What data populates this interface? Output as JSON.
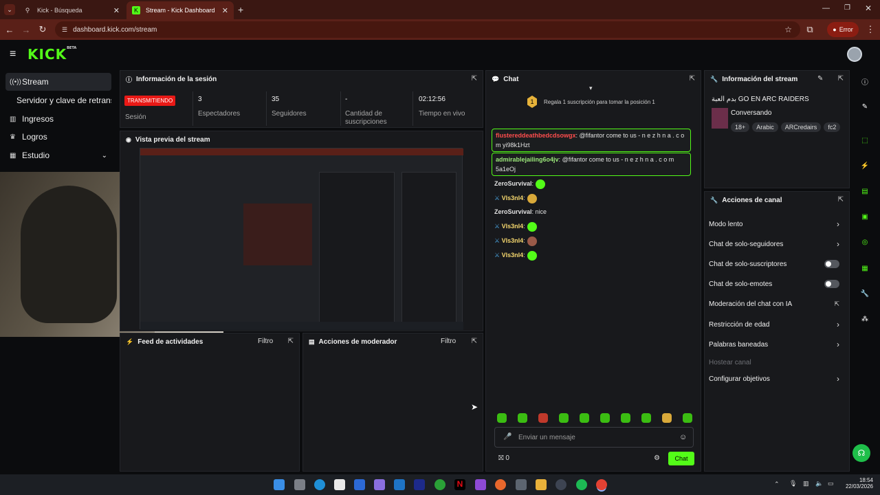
{
  "browser": {
    "tabs": [
      {
        "title": "Kick - Búsqueda",
        "active": false
      },
      {
        "title": "Stream - Kick Dashboard",
        "active": true
      }
    ],
    "url": "dashboard.kick.com/stream",
    "error_label": "Error"
  },
  "header": {
    "logo": "KICK",
    "logo_badge": "BETA"
  },
  "sidebar": {
    "items": [
      {
        "label": "Stream",
        "icon": "broadcast-icon",
        "active": true
      },
      {
        "label": "Servidor y clave de retransmi",
        "icon": "",
        "active": false
      },
      {
        "label": "Ingresos",
        "icon": "chart-icon",
        "active": false
      },
      {
        "label": "Logros",
        "icon": "trophy-icon",
        "active": false
      },
      {
        "label": "Estudio",
        "icon": "film-icon",
        "active": false
      }
    ]
  },
  "session": {
    "title": "Información de la sesión",
    "status_badge": "TRANSMITIENDO",
    "status_label": "Sesión",
    "stats": [
      {
        "value": "3",
        "label": "Espectadores"
      },
      {
        "value": "35",
        "label": "Seguidores"
      },
      {
        "value": "-",
        "label": "Cantidad de suscripciones"
      },
      {
        "value": "02:12:56",
        "label": "Tiempo en vivo"
      }
    ]
  },
  "preview": {
    "title": "Vista previa del stream"
  },
  "feed": {
    "title": "Feed de actividades",
    "filter": "Filtro"
  },
  "modactions": {
    "title": "Acciones de moderador",
    "filter": "Filtro"
  },
  "chat": {
    "title": "Chat",
    "gift_text": "Regala 1 suscripción para tomar la posición 1",
    "gift_rank": "1",
    "messages": [
      {
        "user": "flustereddeathbedcdsowgx",
        "text": "@fifantor come to us - n e z h n a . c o m yi98k1Hzt",
        "flagged": true,
        "color": "#ff4d4d"
      },
      {
        "user": "admirablejailing6o4jv",
        "text": "@fifantor come to us - n e z h n a . c o m 5a1eOj",
        "flagged": true,
        "color": "#9be87a"
      },
      {
        "user": "ZeroSurvival",
        "text": "",
        "emote": true,
        "color": "#d7e8c8"
      },
      {
        "user": "Vls3nI4",
        "text": "",
        "emote": true,
        "color": "#f5d76e"
      },
      {
        "user": "ZeroSurvival",
        "text": "nice",
        "emote": false,
        "color": "#d7e8c8"
      },
      {
        "user": "Vls3nI4",
        "text": "",
        "emote": true,
        "color": "#f5d76e"
      },
      {
        "user": "Vls3nI4",
        "text": "",
        "emote": true,
        "color": "#f5d76e"
      },
      {
        "user": "Vls3nI4",
        "text": "",
        "emote": true,
        "color": "#f5d76e"
      }
    ],
    "input_placeholder": "Enviar un mensaje",
    "points": "0",
    "send_label": "Chat"
  },
  "stream_info": {
    "title": "Información del stream",
    "stream_title": "بدم العبة GO EN ARC RAIDERS",
    "category": "Conversando",
    "tags": [
      "18+",
      "Arabic",
      "ARCredairs",
      "fc2"
    ]
  },
  "channel_actions": {
    "title": "Acciones de canal",
    "items": [
      {
        "label": "Modo lento",
        "control": "chevron"
      },
      {
        "label": "Chat de solo-seguidores",
        "control": "chevron"
      },
      {
        "label": "Chat de solo-suscriptores",
        "control": "toggle"
      },
      {
        "label": "Chat de solo-emotes",
        "control": "toggle"
      },
      {
        "label": "Moderación del chat con IA",
        "control": "external"
      },
      {
        "label": "Restricción de edad",
        "control": "chevron"
      },
      {
        "label": "Palabras baneadas",
        "control": "chevron"
      },
      {
        "label": "Hostear canal",
        "control": "none",
        "disabled": true
      },
      {
        "label": "Configurar objetivos",
        "control": "chevron"
      }
    ]
  },
  "taskbar": {
    "time": "18:54",
    "date": "22/03/2026"
  },
  "colors": {
    "accent": "#53fc18",
    "live": "#e91916",
    "panel": "#18191c"
  }
}
